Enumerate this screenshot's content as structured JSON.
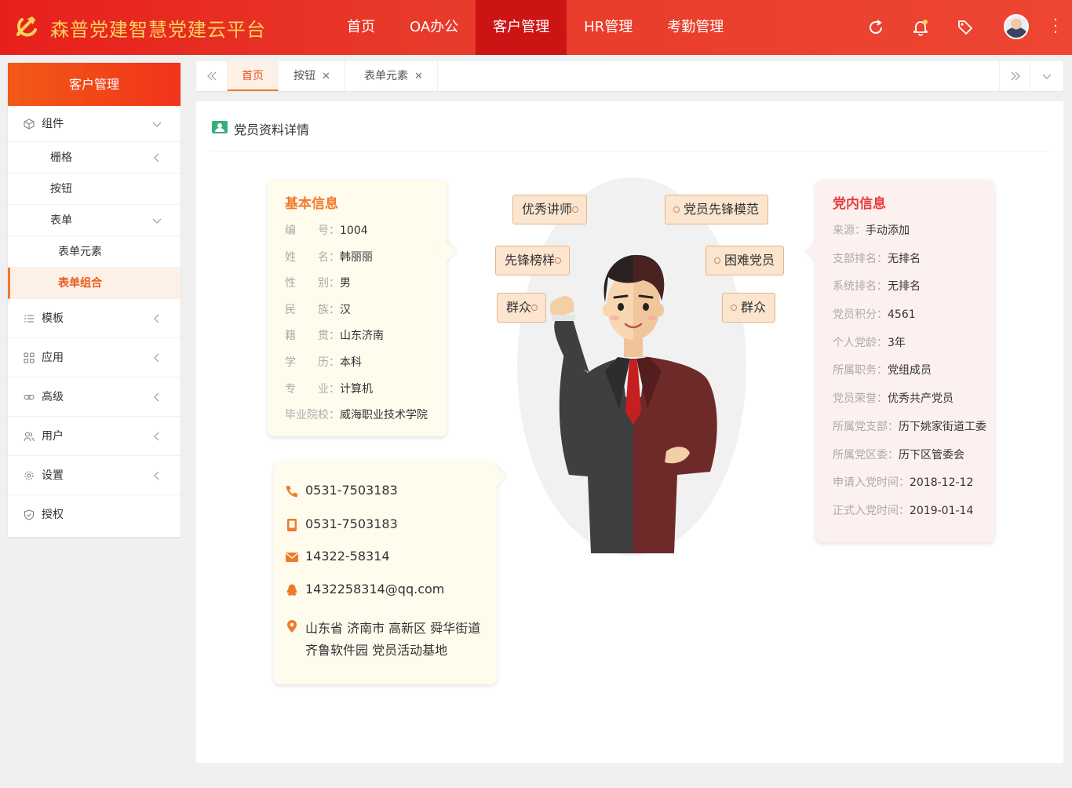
{
  "header": {
    "brand": "森普党建智慧党建云平台",
    "nav": [
      "首页",
      "OA办公",
      "客户管理",
      "HR管理",
      "考勤管理"
    ],
    "active_nav": "客户管理",
    "accent": "#e8201c"
  },
  "sidebar": {
    "title": "客户管理",
    "items": {
      "components": "组件",
      "grid": "栅格",
      "button": "按钮",
      "form": "表单",
      "form_elements": "表单元素",
      "form_combo": "表单组合",
      "template": "模板",
      "apps": "应用",
      "advanced": "高级",
      "users": "用户",
      "settings": "设置",
      "auth": "授权"
    }
  },
  "tabs": {
    "home": "首页",
    "button": "按钮",
    "form_elements": "表单元素",
    "close": "✕"
  },
  "page": {
    "title": "党员资料详情"
  },
  "basic_info": {
    "title": "基本信息",
    "rows": [
      {
        "label": "编号",
        "value": "1004"
      },
      {
        "label": "姓名",
        "value": "韩丽丽"
      },
      {
        "label": "性别",
        "value": "男"
      },
      {
        "label": "民族",
        "value": "汉"
      },
      {
        "label": "籍贯",
        "value": "山东济南"
      },
      {
        "label": "学历",
        "value": "本科"
      },
      {
        "label": "专业",
        "value": "计算机"
      },
      {
        "label": "毕业院校",
        "value": "威海职业技术学院"
      }
    ]
  },
  "contact": {
    "phone": "0531-7503183",
    "mobile": "0531-7503183",
    "fax": "14322-58314",
    "qq": "1432258314@qq.com",
    "address_line1": "山东省 济南市 高新区 舜华街道",
    "address_line2": "齐鲁软件园 党员活动基地"
  },
  "tags": {
    "left": [
      "优秀讲师",
      "先锋榜样",
      "群众"
    ],
    "right": [
      "党员先锋模范",
      "困难党员",
      "群众"
    ]
  },
  "party_info": {
    "title": "党内信息",
    "rows": [
      {
        "label": "来源",
        "value": "手动添加"
      },
      {
        "label": "支部排名",
        "value": "无排名"
      },
      {
        "label": "系统排名",
        "value": "无排名"
      },
      {
        "label": "党员积分",
        "value": "4561"
      },
      {
        "label": "个人党龄",
        "value": "3年"
      },
      {
        "label": "所属职务",
        "value": "党组成员"
      },
      {
        "label": "党员荣誉",
        "value": "优秀共产党员"
      },
      {
        "label": "所属党支部",
        "value": "历下姚家街道工委"
      },
      {
        "label": "所属党区委",
        "value": "历下区管委会"
      },
      {
        "label": "申请入党时间",
        "value": "2018-12-12"
      },
      {
        "label": "正式入党时间",
        "value": "2019-01-14"
      }
    ]
  }
}
